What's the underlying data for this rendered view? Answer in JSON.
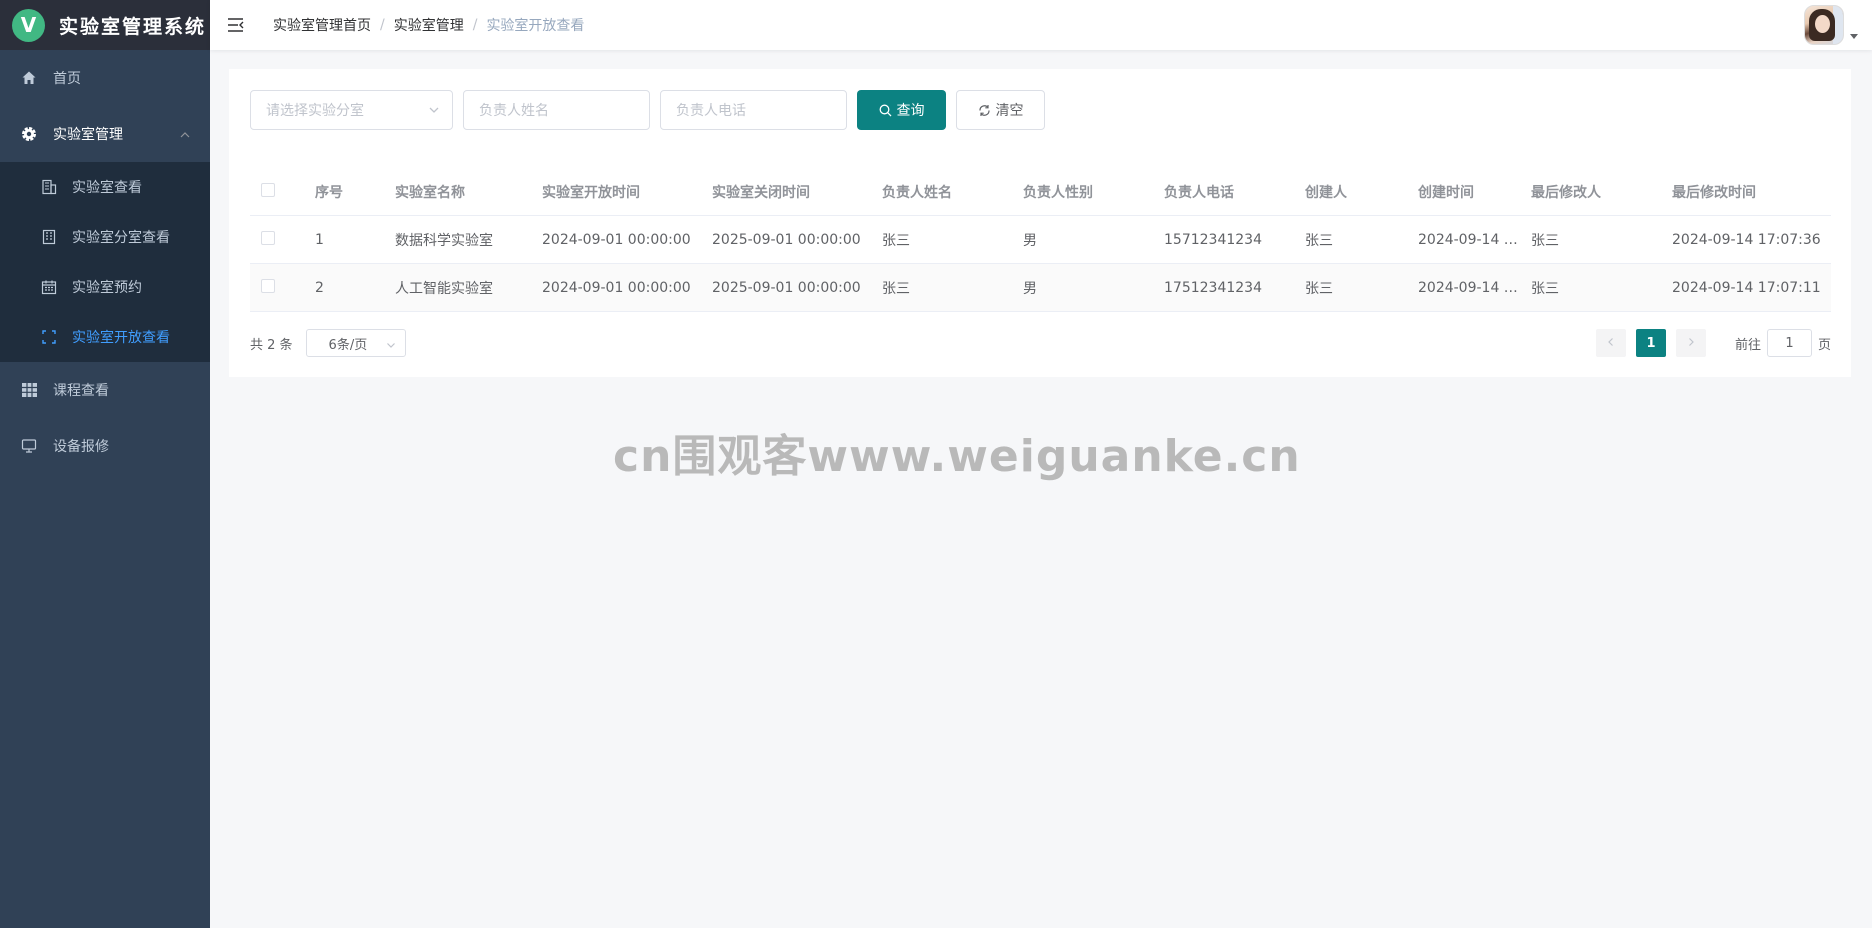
{
  "app": {
    "logo_letter": "V",
    "title": "实验室管理系统",
    "colors": {
      "sidebar_bg": "#304156",
      "logo_bg": "#2b2f3a",
      "submenu_bg": "#1f2d3d",
      "accent": "#409eff",
      "primary_button": "#0c8282",
      "logo_mark": "#41b883"
    }
  },
  "sidebar": {
    "items": [
      {
        "label": "首页",
        "icon": "home-icon"
      },
      {
        "label": "实验室管理",
        "icon": "gear-icon",
        "expanded": true,
        "children": [
          {
            "label": "实验室查看",
            "icon": "building-icon"
          },
          {
            "label": "实验室分室查看",
            "icon": "office-building-icon"
          },
          {
            "label": "实验室预约",
            "icon": "calendar-icon"
          },
          {
            "label": "实验室开放查看",
            "icon": "fullscreen-icon",
            "active": true
          }
        ]
      },
      {
        "label": "课程查看",
        "icon": "grid-icon"
      },
      {
        "label": "设备报修",
        "icon": "monitor-icon"
      }
    ]
  },
  "header": {
    "breadcrumb": [
      "实验室管理首页",
      "实验室管理",
      "实验室开放查看"
    ],
    "separator": "/"
  },
  "search": {
    "branch_placeholder": "请选择实验分室",
    "name_placeholder": "负责人姓名",
    "phone_placeholder": "负责人电话",
    "query_label": "查询",
    "clear_label": "清空"
  },
  "table": {
    "columns": [
      "序号",
      "实验室名称",
      "实验室开放时间",
      "实验室关闭时间",
      "负责人姓名",
      "负责人性别",
      "负责人电话",
      "创建人",
      "创建时间",
      "最后修改人",
      "最后修改时间"
    ],
    "rows": [
      [
        "1",
        "数据科学实验室",
        "2024-09-01 00:00:00",
        "2025-09-01 00:00:00",
        "张三",
        "男",
        "15712341234",
        "张三",
        "2024-09-14 …",
        "张三",
        "2024-09-14 17:07:36"
      ],
      [
        "2",
        "人工智能实验室",
        "2024-09-01 00:00:00",
        "2025-09-01 00:00:00",
        "张三",
        "男",
        "17512341234",
        "张三",
        "2024-09-14 …",
        "张三",
        "2024-09-14 17:07:11"
      ]
    ]
  },
  "pagination": {
    "total": "共 2 条",
    "page_size": "6条/页",
    "current_page": "1",
    "goto_prefix": "前往",
    "goto_value": "1",
    "goto_suffix": "页"
  },
  "watermark": "cn围观客www.weiguanke.cn"
}
